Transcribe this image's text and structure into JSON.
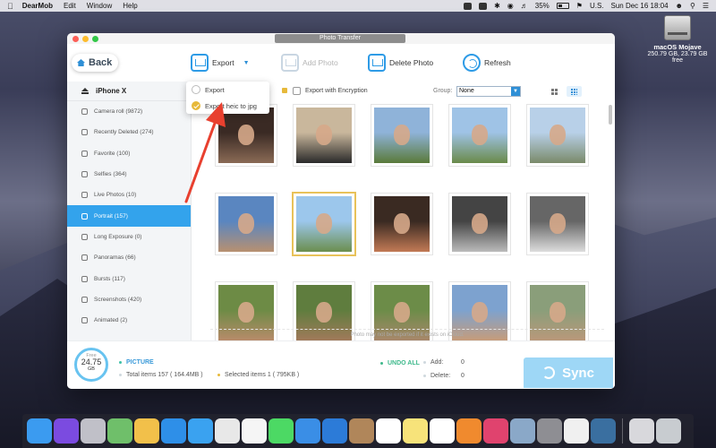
{
  "menubar": {
    "app": "DearMob",
    "items": [
      "Edit",
      "Window",
      "Help"
    ],
    "battery": "35%",
    "input_source": "U.S.",
    "clock": "Sun Dec 16  18:04"
  },
  "desktop": {
    "disk_name": "macOS Mojave",
    "disk_info": "250.79 GB, 23.79 GB free"
  },
  "window": {
    "title": "Photo Transfer",
    "back_label": "Back",
    "toolbar": {
      "export_label": "Export",
      "add_photo_label": "Add Photo",
      "delete_photo_label": "Delete Photo",
      "refresh_label": "Refresh"
    },
    "export_menu": {
      "items": [
        {
          "label": "Export",
          "selected": false
        },
        {
          "label": "Export heic to jpg",
          "selected": true
        }
      ]
    },
    "filter": {
      "encryption_label": "Export with Encryption",
      "group_label": "Group:",
      "group_value": "None"
    },
    "sidebar": {
      "device": "iPhone X",
      "items": [
        {
          "label": "Camera roll (9872)",
          "icon": "camera-icon"
        },
        {
          "label": "Recently Deleted (274)",
          "icon": "trash-icon"
        },
        {
          "label": "Favorite (100)",
          "icon": "heart-icon"
        },
        {
          "label": "Selfies (364)",
          "icon": "user-icon"
        },
        {
          "label": "Live Photos (10)",
          "icon": "live-photo-icon"
        },
        {
          "label": "Portrait (157)",
          "icon": "cube-icon"
        },
        {
          "label": "Long Exposure (0)",
          "icon": "aperture-icon"
        },
        {
          "label": "Panoramas (66)",
          "icon": "panorama-icon"
        },
        {
          "label": "Bursts (117)",
          "icon": "burst-icon"
        },
        {
          "label": "Screenshots (420)",
          "icon": "screenshot-icon"
        },
        {
          "label": "Animated (2)",
          "icon": "animated-icon"
        }
      ],
      "active_index": 5
    },
    "notice": "Photo may not be exported if it exists on iCloud.",
    "footer": {
      "storage_label": "Free",
      "storage_value": "24.75",
      "storage_unit": "GB",
      "picture_label": "PICTURE",
      "total_items": "Total items 157 ( 164.4MB )",
      "selected_items": "Selected items 1 ( 795KB )",
      "undo_all": "UNDO ALL",
      "add_label": "Add:",
      "add_count": "0",
      "delete_label": "Delete:",
      "delete_count": "0",
      "sync_label": "Sync"
    }
  },
  "colors": {
    "accent": "#33a3ec",
    "highlight": "#e7b93a",
    "arrow": "#e8402f"
  }
}
